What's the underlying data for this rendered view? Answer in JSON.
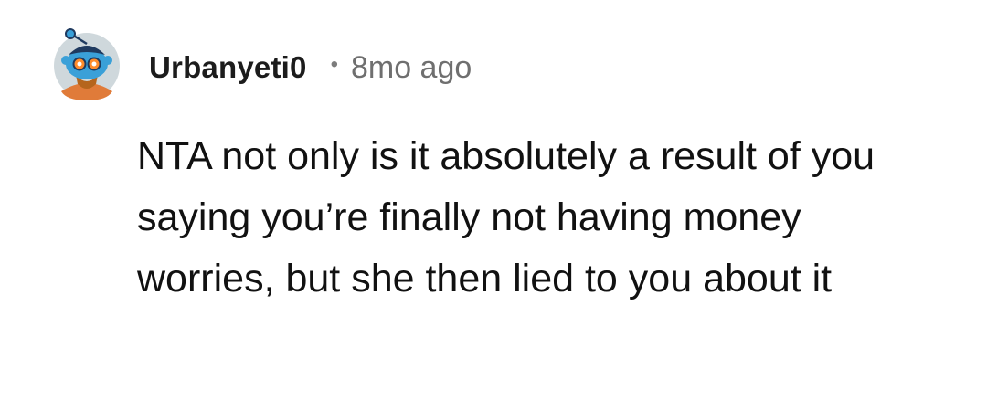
{
  "comment": {
    "author": "Urbanyeti0",
    "separator": "•",
    "timestamp": "8mo ago",
    "avatar_icon": "snoo-avatar-icon",
    "body": "NTA not only is it absolutely a result of you saying you’re finally not having money worries, but she then lied to you about it"
  },
  "colors": {
    "background": "#ffffff",
    "username": "#1c1c1c",
    "timestamp": "#6f6f6f",
    "body_text": "#111111"
  }
}
